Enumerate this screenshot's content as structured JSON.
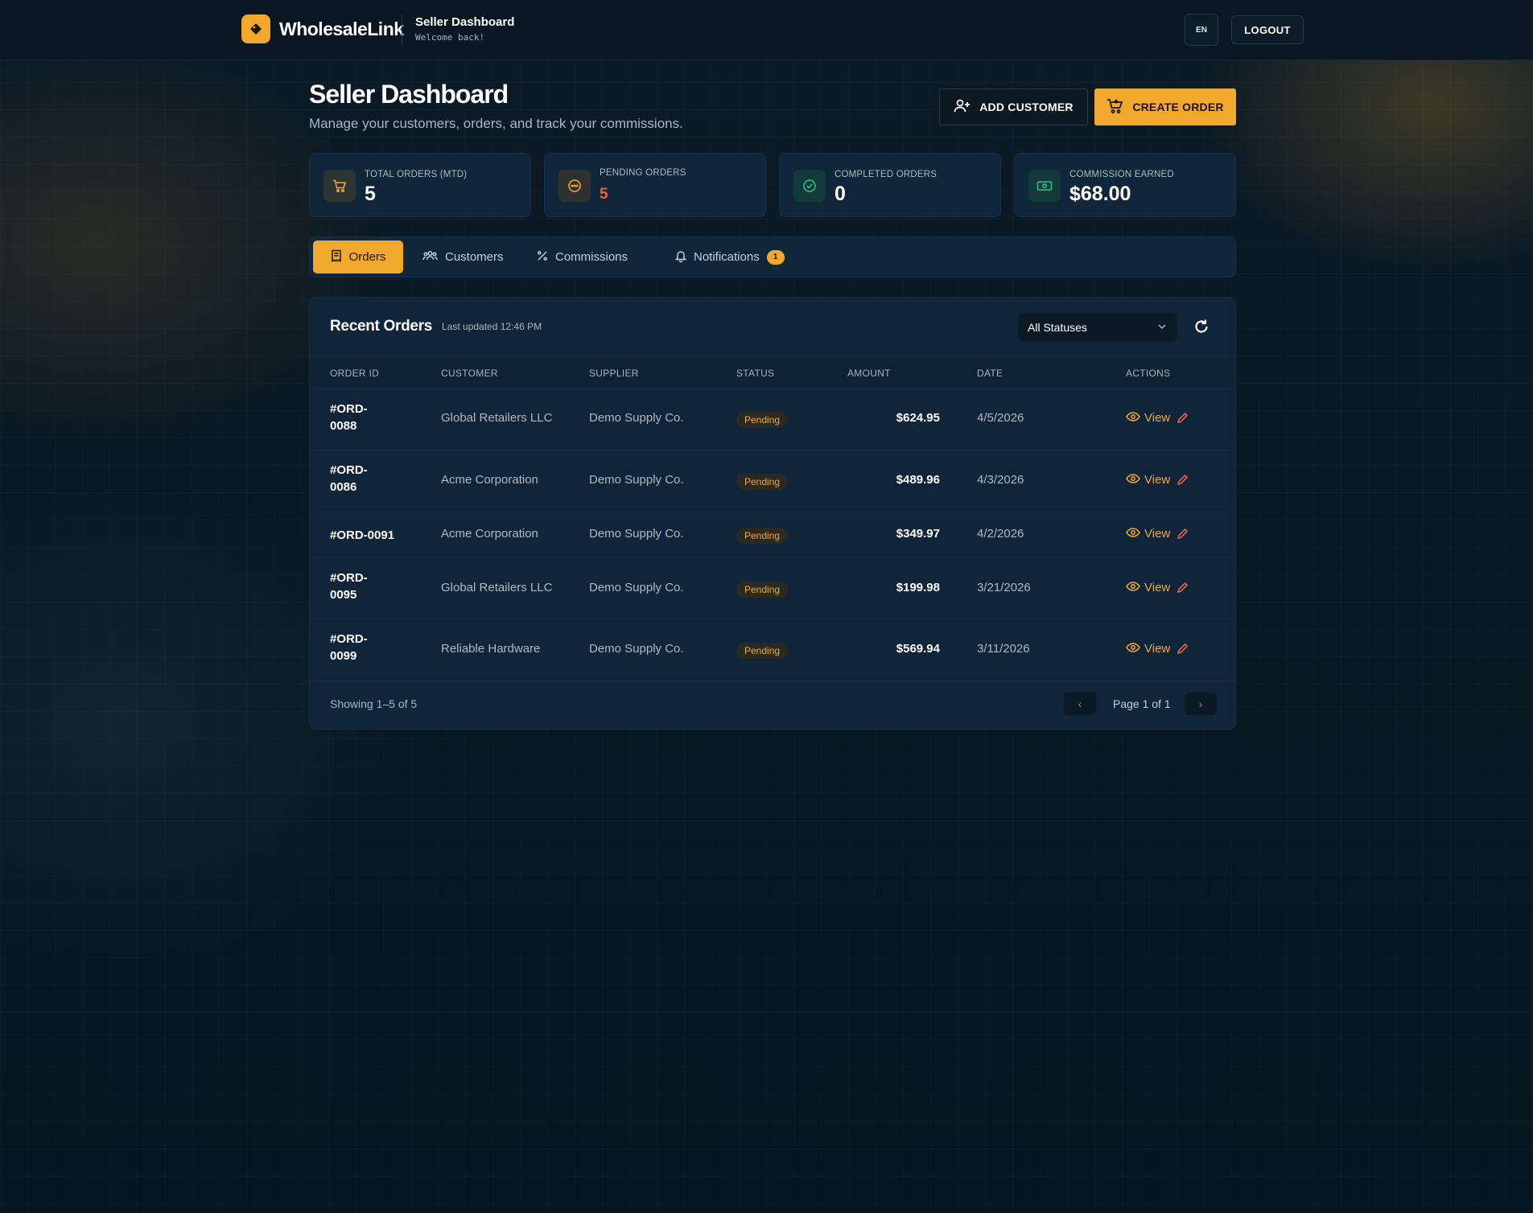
{
  "header": {
    "brand": "WholesaleLink",
    "title": "Seller Dashboard",
    "subtitle": "Welcome back!",
    "language": "EN",
    "logout": "LOGOUT"
  },
  "page": {
    "title": "Seller Dashboard",
    "subtitle": "Manage your customers, orders, and track your commissions.",
    "add_customer": "ADD CUSTOMER",
    "create_order": "CREATE ORDER"
  },
  "stats": [
    {
      "label": "TOTAL ORDERS (MTD)",
      "value": "5",
      "icon": "cart-icon",
      "color": "#f0a92c"
    },
    {
      "label": "PENDING ORDERS",
      "value": "5",
      "icon": "pending-icon",
      "color": "#e0654a"
    },
    {
      "label": "COMPLETED ORDERS",
      "value": "0",
      "icon": "check-circle-icon",
      "color": "#ffffff"
    },
    {
      "label": "COMMISSION EARNED",
      "value": "$68.00",
      "icon": "cash-icon",
      "color": "#ffffff"
    }
  ],
  "tabs": [
    {
      "label": "Orders",
      "icon": "receipt-icon",
      "active": true
    },
    {
      "label": "Customers",
      "icon": "users-icon"
    },
    {
      "label": "Commissions",
      "icon": "percent-icon"
    },
    {
      "label": "Notifications",
      "icon": "bell-icon",
      "badge": "1"
    }
  ],
  "orders": {
    "title": "Recent Orders",
    "updated": "Last updated 12:46 PM",
    "filter": "All Statuses",
    "columns": [
      "ORDER ID",
      "CUSTOMER",
      "SUPPLIER",
      "STATUS",
      "AMOUNT",
      "DATE",
      "ACTIONS"
    ],
    "rows": [
      {
        "id": "#ORD-0088",
        "customer": "Global Retailers LLC",
        "supplier": "Demo Supply Co.",
        "status": "Pending",
        "amount": "$624.95",
        "date": "4/5/2026",
        "action": "View"
      },
      {
        "id": "#ORD-0086",
        "customer": "Acme Corporation",
        "supplier": "Demo Supply Co.",
        "status": "Pending",
        "amount": "$489.96",
        "date": "4/3/2026",
        "action": "View"
      },
      {
        "id": "#ORD-0091",
        "customer": "Acme Corporation",
        "supplier": "Demo Supply Co.",
        "status": "Pending",
        "amount": "$349.97",
        "date": "4/2/2026",
        "action": "View"
      },
      {
        "id": "#ORD-0095",
        "customer": "Global Retailers LLC",
        "supplier": "Demo Supply Co.",
        "status": "Pending",
        "amount": "$199.98",
        "date": "3/21/2026",
        "action": "View"
      },
      {
        "id": "#ORD-0099",
        "customer": "Reliable Hardware",
        "supplier": "Demo Supply Co.",
        "status": "Pending",
        "amount": "$569.94",
        "date": "3/11/2026",
        "action": "View"
      }
    ],
    "showing": "Showing 1–5 of 5",
    "page_text": "Page 1 of 1",
    "prev": "‹",
    "next": "›"
  },
  "colors": {
    "accent": "#f0a92c",
    "pending_value": "#e0654a",
    "success": "#2fbf8a",
    "edit": "#e0654a"
  }
}
